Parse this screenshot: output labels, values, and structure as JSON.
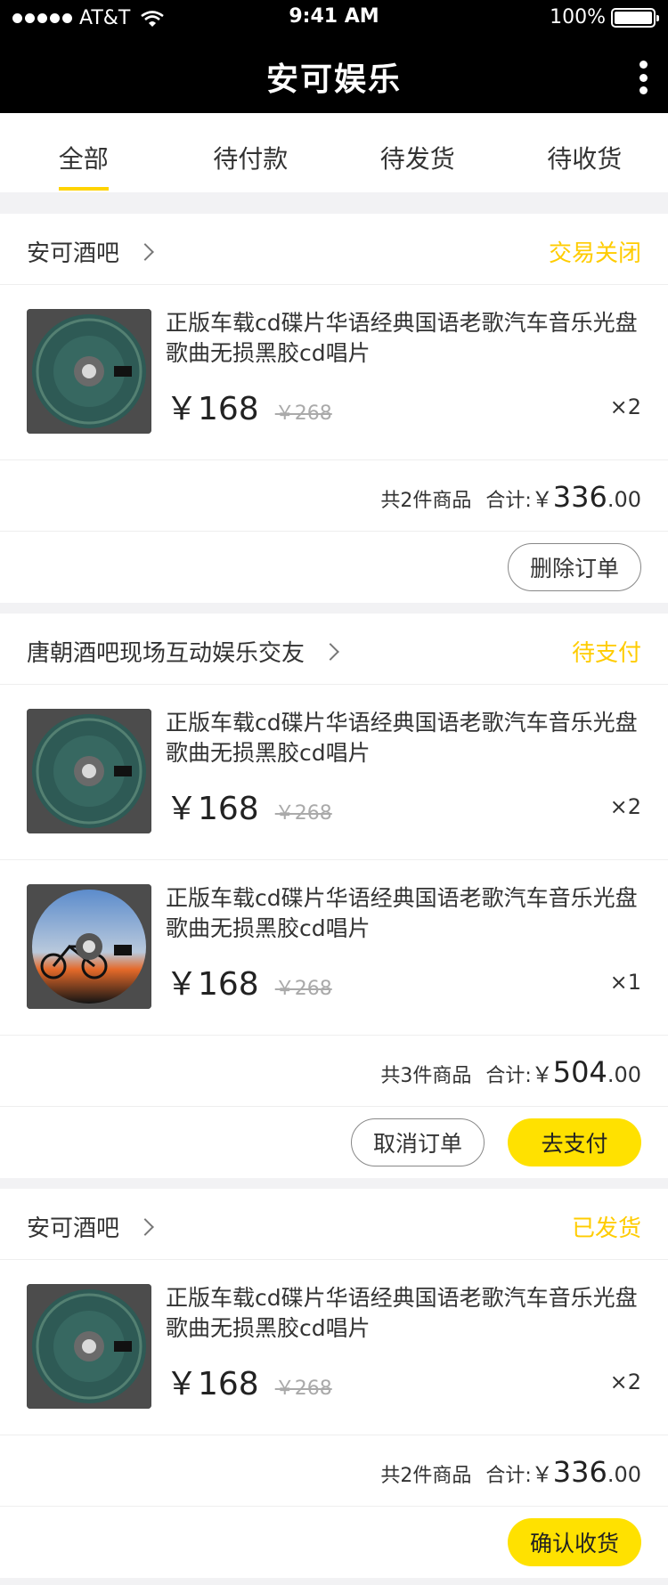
{
  "status": {
    "carrier": "AT&T",
    "time": "9:41 AM",
    "battery": "100%"
  },
  "header": {
    "title": "安可娱乐"
  },
  "tabs": [
    {
      "label": "全部"
    },
    {
      "label": "待付款"
    },
    {
      "label": "待发货"
    },
    {
      "label": "待收货"
    }
  ],
  "orders": [
    {
      "store": "安可酒吧",
      "state": "交易关闭",
      "items": [
        {
          "name": "正版车载cd碟片华语经典国语老歌汽车音乐光盘歌曲无损黑胶cd唱片",
          "price": "￥168",
          "old_price": "￥268",
          "qty": "×2",
          "image": "green-cd"
        }
      ],
      "count_text": "共2件商品",
      "total_label": "合计:",
      "total_yen": "￥",
      "total_int": "336",
      "total_dec": ".00",
      "buttons": [
        "删除订单"
      ]
    },
    {
      "store": "唐朝酒吧现场互动娱乐交友",
      "state": "待支付",
      "items": [
        {
          "name": "正版车载cd碟片华语经典国语老歌汽车音乐光盘歌曲无损黑胶cd唱片",
          "price": "￥168",
          "old_price": "￥268",
          "qty": "×2",
          "image": "green-cd"
        },
        {
          "name": "正版车载cd碟片华语经典国语老歌汽车音乐光盘歌曲无损黑胶cd唱片",
          "price": "￥168",
          "old_price": "￥268",
          "qty": "×1",
          "image": "bike-cd"
        }
      ],
      "count_text": "共3件商品",
      "total_label": "合计:",
      "total_yen": "￥",
      "total_int": "504",
      "total_dec": ".00",
      "buttons": [
        "取消订单",
        "去支付"
      ]
    },
    {
      "store": "安可酒吧",
      "state": "已发货",
      "items": [
        {
          "name": "正版车载cd碟片华语经典国语老歌汽车音乐光盘歌曲无损黑胶cd唱片",
          "price": "￥168",
          "old_price": "￥268",
          "qty": "×2",
          "image": "green-cd"
        }
      ],
      "count_text": "共2件商品",
      "total_label": "合计:",
      "total_yen": "￥",
      "total_int": "336",
      "total_dec": ".00",
      "buttons": [
        "确认收货"
      ]
    }
  ],
  "colors": {
    "accent": "#ffe100",
    "state_text": "#ffcc00"
  },
  "icons": [
    "signal-dots-icon",
    "wifi-icon",
    "battery-icon",
    "more-vertical-icon",
    "chevron-right-icon",
    "cd-thumbnail-icon"
  ]
}
